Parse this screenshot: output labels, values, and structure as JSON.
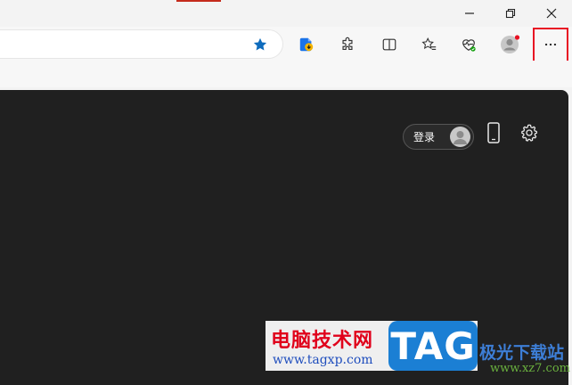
{
  "window": {
    "minimize_icon": "minimize-icon",
    "maximize_icon": "restore-icon",
    "close_icon": "close-icon"
  },
  "toolbar": {
    "icons": [
      "favorite-star-icon",
      "browser-essentials-icon",
      "extensions-icon",
      "split-screen-icon",
      "favorites-icon",
      "health-icon",
      "profile-avatar-icon",
      "more-options-icon"
    ],
    "accent_color": "#0f6cbd",
    "highlight_color": "#e81123"
  },
  "page": {
    "login_label": "登录",
    "phone_icon": "phone-icon",
    "settings_icon": "settings-gear-icon",
    "background": "#202020"
  },
  "watermark": {
    "title": "电脑技术网",
    "url": "www.tagxp.com",
    "logo_text": "TAG",
    "site_name": "极光下载站",
    "site_url": "www.xz7.com"
  }
}
